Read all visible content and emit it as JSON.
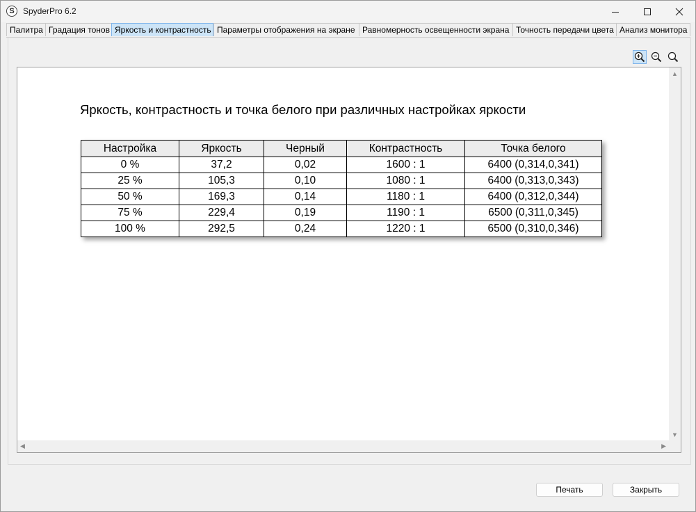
{
  "window": {
    "title": "SpyderPro 6.2",
    "app_icon_letter": "S"
  },
  "tabs": [
    {
      "label": "Палитра",
      "active": false
    },
    {
      "label": "Градация тонов",
      "active": false
    },
    {
      "label": "Яркость и контрастность",
      "active": true
    },
    {
      "label": "Параметры отображения на экране",
      "active": false
    },
    {
      "label": "Равномерность освещенности экрана",
      "active": false
    },
    {
      "label": "Точность передачи цвета",
      "active": false
    },
    {
      "label": "Анализ монитора",
      "active": false
    }
  ],
  "toolbar": {
    "icons": [
      "zoom-in-icon",
      "zoom-out-icon",
      "zoom-fit-icon"
    ]
  },
  "report": {
    "title": "Яркость, контрастность и точка белого при различных настройках яркости",
    "columns": [
      "Настройка",
      "Яркость",
      "Черный",
      "Контрастность",
      "Точка белого"
    ],
    "rows": [
      [
        "0 %",
        "37,2",
        "0,02",
        "1600 : 1",
        "6400 (0,314,0,341)"
      ],
      [
        "25 %",
        "105,3",
        "0,10",
        "1080 : 1",
        "6400 (0,313,0,343)"
      ],
      [
        "50 %",
        "169,3",
        "0,14",
        "1180 : 1",
        "6400 (0,312,0,344)"
      ],
      [
        "75 %",
        "229,4",
        "0,19",
        "1190 : 1",
        "6500 (0,311,0,345)"
      ],
      [
        "100 %",
        "292,5",
        "0,24",
        "1220 : 1",
        "6500 (0,310,0,346)"
      ]
    ]
  },
  "buttons": {
    "print": "Печать",
    "close": "Закрыть"
  },
  "colors": {
    "active_tab": "#cce4f7",
    "active_tab_border": "#7eb4ea"
  }
}
